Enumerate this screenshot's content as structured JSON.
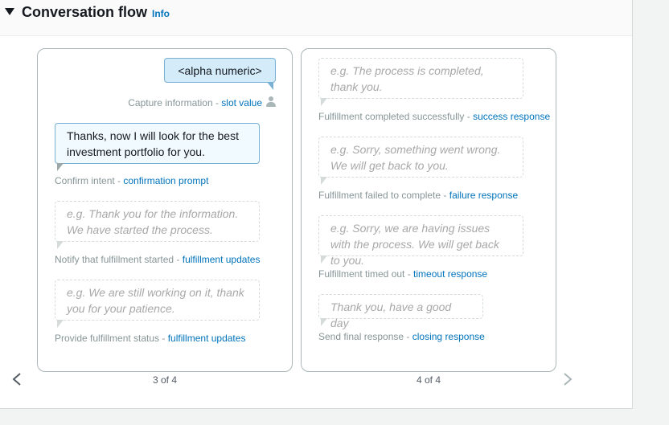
{
  "section": {
    "title": "Conversation flow",
    "info_link": "Info"
  },
  "cards": [
    {
      "page": "3 of 4",
      "capture": {
        "bubble": "<alpha numeric>",
        "label": "Capture information - ",
        "link": "slot value",
        "icon": "person-icon"
      },
      "confirm": {
        "bubble": "Thanks, now I will look for the best investment portfolio for you.",
        "label": "Confirm intent - ",
        "link": "confirmation prompt"
      },
      "notify": {
        "placeholder": "e.g. Thank you for the information. We have started the process.",
        "label": "Notify that fulfillment started - ",
        "link": "fulfillment updates"
      },
      "status": {
        "placeholder": "e.g. We are still working on it, thank you for your patience.",
        "label": "Provide fulfillment status - ",
        "link": "fulfillment updates"
      }
    },
    {
      "page": "4 of 4",
      "success": {
        "placeholder": "e.g. The process is completed, thank you.",
        "label": "Fulfillment completed successfully - ",
        "link": "success response"
      },
      "failure": {
        "placeholder": "e.g. Sorry, something went wrong. We will get back to you.",
        "label": "Fulfillment failed to complete - ",
        "link": "failure response"
      },
      "timeout": {
        "placeholder": "e.g. Sorry, we are having issues with the process. We will get back to you.",
        "label": "Fulfillment timed out - ",
        "link": "timeout response"
      },
      "closing": {
        "placeholder": "Thank you, have a good day",
        "label": "Send final response - ",
        "link": "closing response"
      }
    }
  ],
  "nav": {
    "prev_icon": "chevron-left-icon",
    "next_icon": "chevron-right-icon"
  },
  "colors": {
    "link": "#0073bb",
    "user_bubble": "#d4ecfa",
    "bot_bubble": "#f1faff",
    "placeholder_text": "#a8a8a8"
  }
}
